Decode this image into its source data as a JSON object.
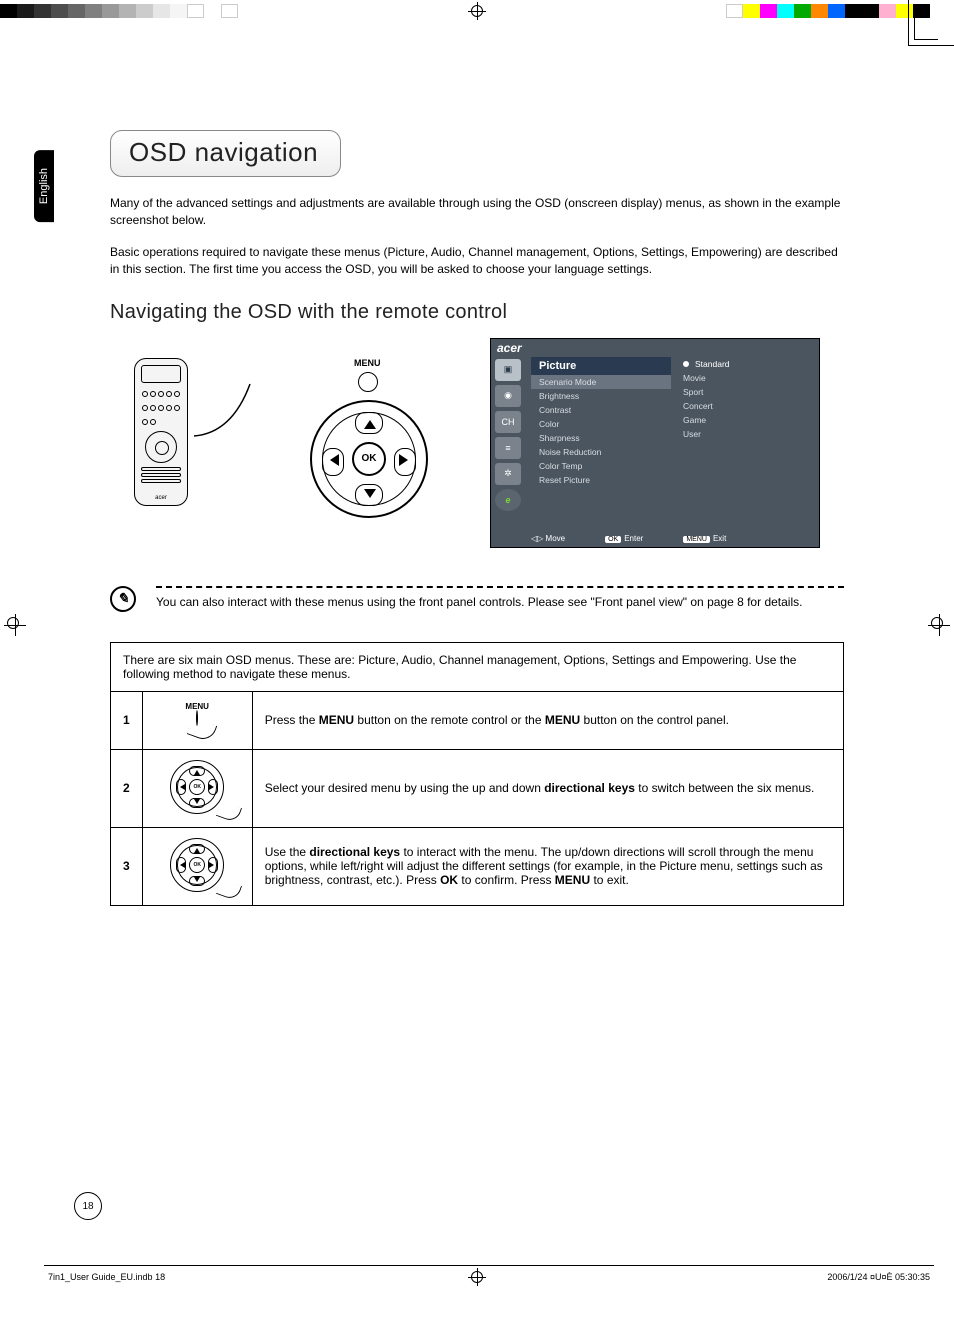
{
  "lang_tab": "English",
  "title": "OSD navigation",
  "intro": {
    "p1": "Many of the advanced settings and adjustments are available through using the OSD (onscreen display) menus, as shown in the example screenshot below.",
    "p2": "Basic operations required to navigate these menus (Picture, Audio, Channel management, Options, Settings, Empowering) are described in this section. The first time you access the OSD, you will be asked to choose your language settings."
  },
  "subhead": "Navigating the OSD with the remote control",
  "remote_fig": {
    "menu_label": "MENU",
    "ok_label": "OK",
    "brand": "acer"
  },
  "osd": {
    "brand": "acer",
    "menu_title": "Picture",
    "menu_items": [
      "Scenario Mode",
      "Brightness",
      "Contrast",
      "Color",
      "Sharpness",
      "Noise Reduction",
      "Color Temp",
      "Reset Picture"
    ],
    "options": [
      {
        "label": "Standard",
        "selected": true
      },
      {
        "label": "Movie",
        "selected": false
      },
      {
        "label": "Sport",
        "selected": false
      },
      {
        "label": "Concert",
        "selected": false
      },
      {
        "label": "Game",
        "selected": false
      },
      {
        "label": "User",
        "selected": false
      }
    ],
    "hints": {
      "move": "Move",
      "enter": "Enter",
      "enter_tag": "OK",
      "exit": "Exit",
      "exit_tag": "MENU"
    }
  },
  "note": "You can also interact with these menus using the front panel controls. Please see \"Front panel view\" on page 8 for details.",
  "table": {
    "intro": "There are six main OSD menus. These are: Picture, Audio, Channel management, Options, Settings and Empowering. Use the following method to navigate these menus.",
    "rows": [
      {
        "num": "1",
        "img_label": "MENU",
        "text_pre": "Press the ",
        "bold1": "MENU",
        "text_mid": " button on the remote control or the ",
        "bold2": "MENU",
        "text_post": " button on the control panel."
      },
      {
        "num": "2",
        "ok": "OK",
        "text_pre": "Select your desired menu by using the up and down ",
        "bold1": "directional keys",
        "text_post": " to switch between the six menus."
      },
      {
        "num": "3",
        "ok": "OK",
        "text_pre": "Use the ",
        "bold1": "directional keys",
        "text_mid": " to interact with the menu. The up/down directions will scroll through the menu options, while left/right will adjust the different settings (for example, in the Picture menu, settings such as brightness, contrast, etc.). Press ",
        "bold2": "OK",
        "text_mid2": " to confirm. Press ",
        "bold3": "MENU",
        "text_post": " to exit."
      }
    ]
  },
  "page_number": "18",
  "footer_left": "7in1_User Guide_EU.indb   18",
  "footer_right": "2006/1/24   ¤U¤È 05:30:35"
}
